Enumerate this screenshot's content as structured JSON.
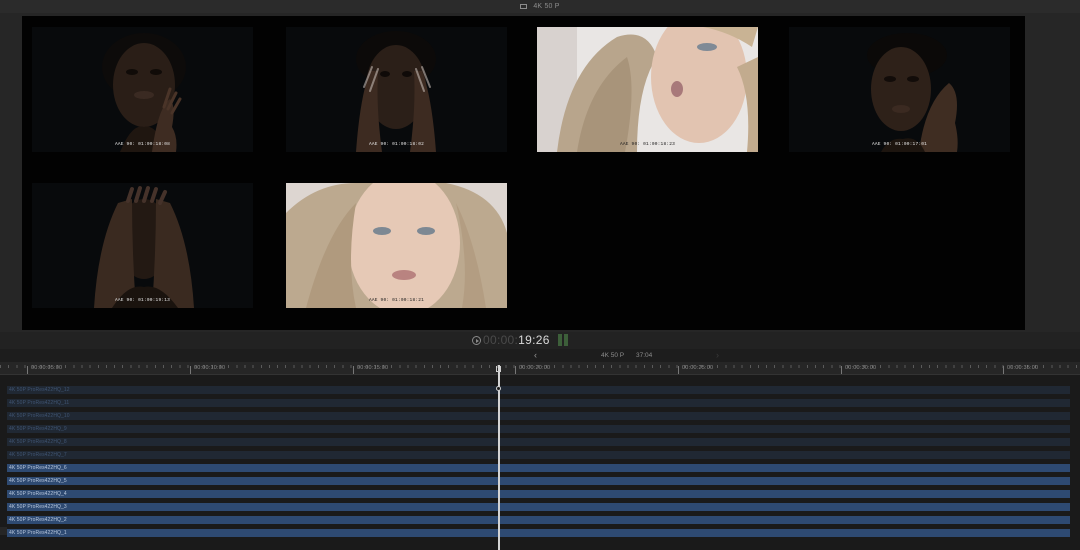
{
  "window": {
    "title": "4K 50 P"
  },
  "viewer": {
    "tiles": [
      {
        "timecode": "AAE 90: 01:00:18:08"
      },
      {
        "timecode": "AAE 90: 01:00:18:02"
      },
      {
        "timecode": "AAE 90: 01:00:18:23"
      },
      {
        "timecode": "AAE 90: 01:00:17:01"
      },
      {
        "timecode": "AAE 90: 01:00:19:13"
      },
      {
        "timecode": "AAE 90: 01:00:18:21"
      }
    ]
  },
  "transport": {
    "timecode_dim": "00:00:",
    "timecode_bright": "19:26"
  },
  "timeline_header": {
    "back": "‹",
    "forward": "›",
    "format": "4K 50 P",
    "duration": "37:04"
  },
  "ruler": {
    "labels": [
      "00:00:05:00",
      "00:00:10:00",
      "00:00:15:00",
      "00:00:20:00",
      "00:00:25:00",
      "00:00:30:00",
      "00:00:35:00"
    ]
  },
  "tracks": [
    {
      "label": "4K 50P ProRes422HQ_12",
      "state": "disabled"
    },
    {
      "label": "4K 50P ProRes422HQ_11",
      "state": "disabled"
    },
    {
      "label": "4K 50P ProRes422HQ_10",
      "state": "disabled"
    },
    {
      "label": "4K 50P ProRes422HQ_9",
      "state": "disabled"
    },
    {
      "label": "4K 50P ProRes422HQ_8",
      "state": "disabled"
    },
    {
      "label": "4K 50P ProRes422HQ_7",
      "state": "disabled"
    },
    {
      "label": "4K 50P ProRes422HQ_6",
      "state": "enabled"
    },
    {
      "label": "4K 50P ProRes422HQ_5",
      "state": "enabled"
    },
    {
      "label": "4K 50P ProRes422HQ_4",
      "state": "enabled"
    },
    {
      "label": "4K 50P ProRes422HQ_3",
      "state": "enabled"
    },
    {
      "label": "4K 50P ProRes422HQ_2",
      "state": "enabled"
    },
    {
      "label": "4K 50P ProRes422HQ_1",
      "state": "enabled"
    }
  ],
  "colors": {
    "track_enabled": "#2e4a72",
    "track_disabled": "#202833",
    "playhead": "#d4d4d4",
    "audio_meter": "#3d5f3a"
  }
}
